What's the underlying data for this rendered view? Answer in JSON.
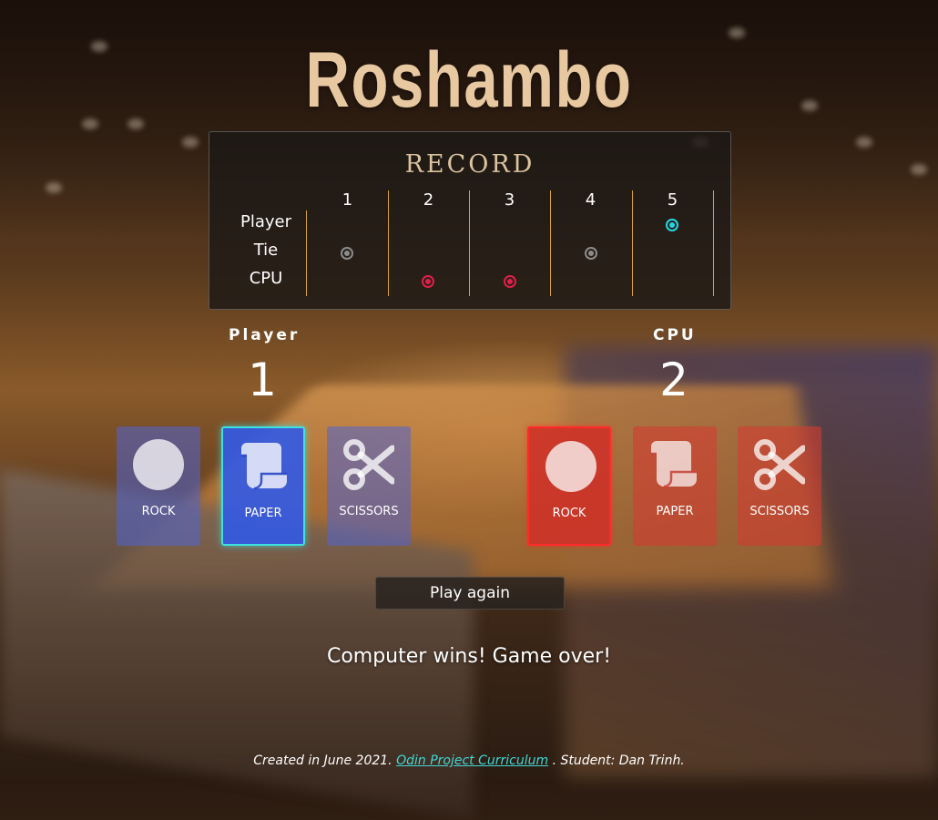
{
  "title": "Roshambo",
  "record": {
    "heading": "RECORD",
    "row_labels": [
      "Player",
      "Tie",
      "CPU"
    ],
    "rounds": [
      "1",
      "2",
      "3",
      "4",
      "5"
    ],
    "results": [
      "Tie",
      "CPU",
      "CPU",
      "Tie",
      "Player"
    ]
  },
  "player": {
    "label": "Player",
    "score": "1",
    "selected": "PAPER"
  },
  "cpu": {
    "label": "CPU",
    "score": "2",
    "selected": "ROCK"
  },
  "choices": [
    "ROCK",
    "PAPER",
    "SCISSORS"
  ],
  "play_again_label": "Play again",
  "message": "Computer wins! Game over!",
  "footer": {
    "prefix": "Created in June 2021.",
    "link_text": "Odin Project Curriculum",
    "suffix": ". Student: Dan Trinh."
  },
  "colors": {
    "player_accent": "#23d8e6",
    "cpu_accent": "#e0204a",
    "tie": "#8c8c8c",
    "divider": "#d6a23c"
  }
}
